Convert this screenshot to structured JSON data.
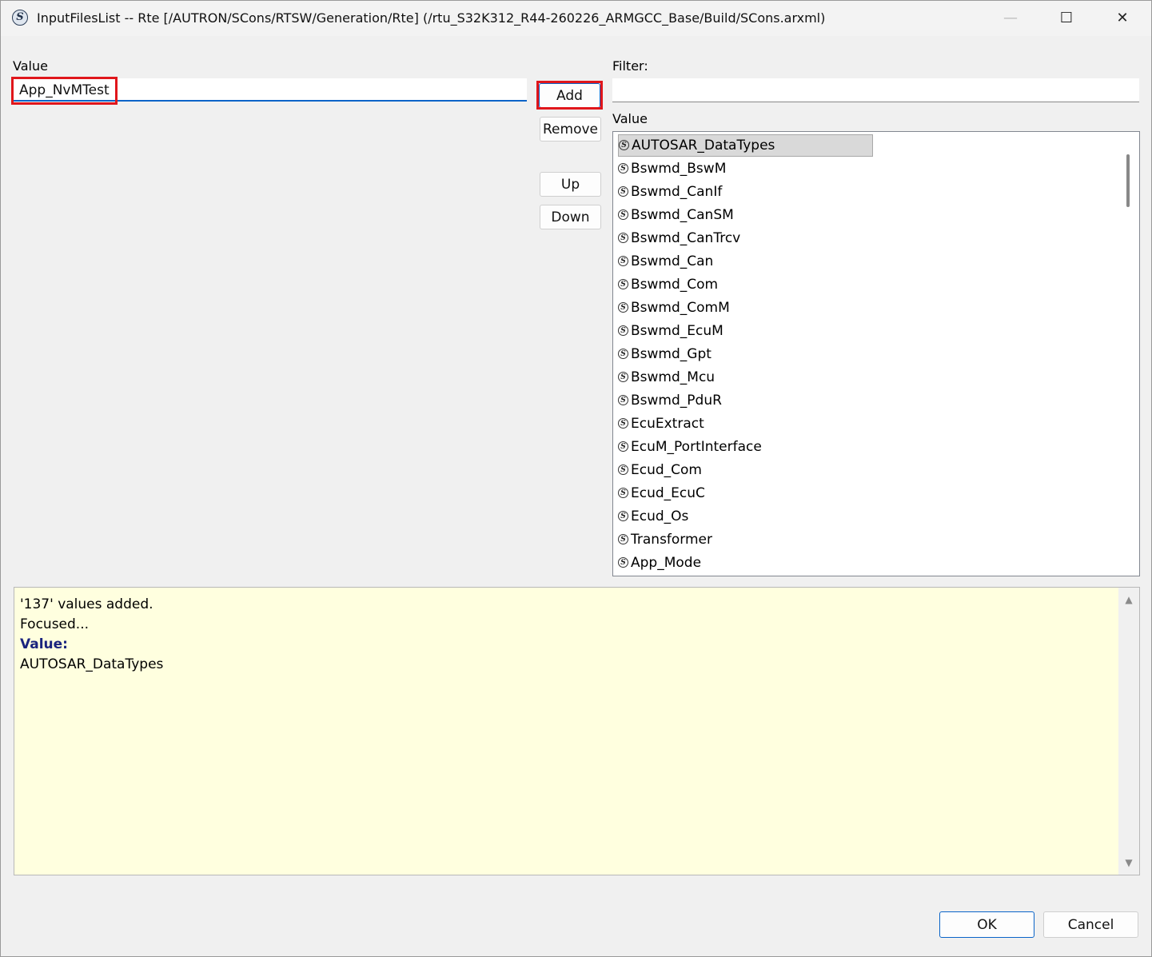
{
  "titlebar": {
    "title": "InputFilesList -- Rte [/AUTRON/SCons/RTSW/Generation/Rte] (/rtu_S32K312_R44-260226_ARMGCC_Base/Build/SCons.arxml)",
    "app_icon": "S",
    "minimize_glyph": "—",
    "maximize_glyph": "☐",
    "close_glyph": "✕"
  },
  "left": {
    "value_label": "Value",
    "value_input": "App_NvMTest"
  },
  "buttons": {
    "add": "Add",
    "remove": "Remove",
    "up": "Up",
    "down": "Down",
    "ok": "OK",
    "cancel": "Cancel"
  },
  "right": {
    "filter_label": "Filter:",
    "filter_value": "",
    "value_label": "Value",
    "item_icon": "S",
    "items": [
      "AUTOSAR_DataTypes",
      "Bswmd_BswM",
      "Bswmd_CanIf",
      "Bswmd_CanSM",
      "Bswmd_CanTrcv",
      "Bswmd_Can",
      "Bswmd_Com",
      "Bswmd_ComM",
      "Bswmd_EcuM",
      "Bswmd_Gpt",
      "Bswmd_Mcu",
      "Bswmd_PduR",
      "EcuExtract",
      "EcuM_PortInterface",
      "Ecud_Com",
      "Ecud_EcuC",
      "Ecud_Os",
      "Transformer",
      "App_Mode"
    ]
  },
  "message": {
    "lines": [
      "'137' values added.",
      "Focused...",
      "Value:",
      "AUTOSAR_DataTypes"
    ],
    "up_arrow": "▲",
    "down_arrow": "▼"
  }
}
